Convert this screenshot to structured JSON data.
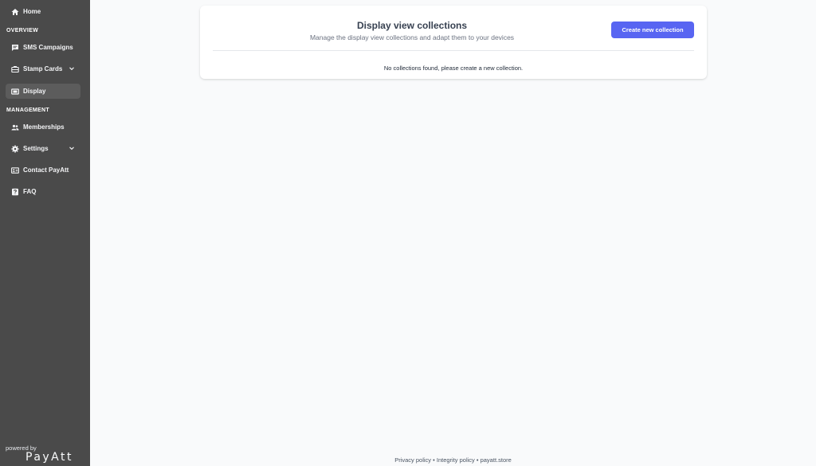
{
  "sidebar": {
    "home": {
      "label": "Home",
      "icon": "home-icon"
    },
    "overview_label": "OVERVIEW",
    "sms": {
      "label": "SMS Campaigns",
      "icon": "message-icon"
    },
    "stamp_cards": {
      "label": "Stamp Cards",
      "icon": "stamp-card-icon"
    },
    "display": {
      "label": "Display",
      "icon": "display-icon",
      "active": true
    },
    "management_label": "MANAGEMENT",
    "memberships": {
      "label": "Memberships",
      "icon": "users-icon"
    },
    "settings": {
      "label": "Settings",
      "icon": "gear-icon"
    },
    "contact": {
      "label": "Contact PayAtt",
      "icon": "contact-card-icon"
    },
    "faq": {
      "label": "FAQ",
      "icon": "question-icon"
    },
    "powered_by": "powered by",
    "brand": "PayAtt"
  },
  "main": {
    "title": "Display view collections",
    "subtitle": "Manage the display view collections and adapt them to your devices",
    "create_button": "Create new collection",
    "empty_message": "No collections found, please create a new collection."
  },
  "footer": {
    "privacy": "Privacy policy",
    "integrity": "Integrity policy",
    "site": "payatt.store",
    "separator": " • "
  },
  "colors": {
    "sidebar_bg": "#4a4a4a",
    "accent": "#5865f2",
    "page_bg": "#f9fafb"
  }
}
